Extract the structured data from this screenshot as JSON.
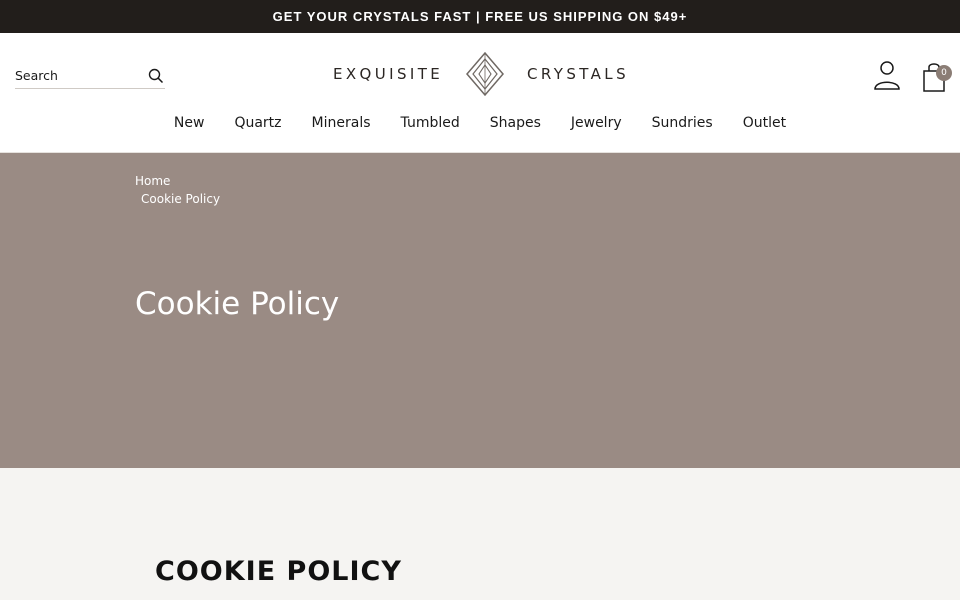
{
  "promo": {
    "text": "GET YOUR CRYSTALS FAST | FREE US SHIPPING ON $49+"
  },
  "header": {
    "search_placeholder": "Search",
    "logo_left": "EXQUISITE",
    "logo_right": "CRYSTALS",
    "cart_count": "0"
  },
  "nav": {
    "items": [
      "New",
      "Quartz",
      "Minerals",
      "Tumbled",
      "Shapes",
      "Jewelry",
      "Sundries",
      "Outlet"
    ]
  },
  "breadcrumb": {
    "home": "Home",
    "current": "Cookie Policy"
  },
  "hero": {
    "title": "Cookie Policy"
  },
  "content": {
    "heading": "COOKIE POLICY"
  },
  "colors": {
    "promo_bg": "#221e1b",
    "hero_bg": "#9a8b84",
    "badge": "#8b7d75"
  },
  "icons": [
    "search-icon",
    "logo-diamond-icon",
    "account-icon",
    "cart-icon"
  ]
}
